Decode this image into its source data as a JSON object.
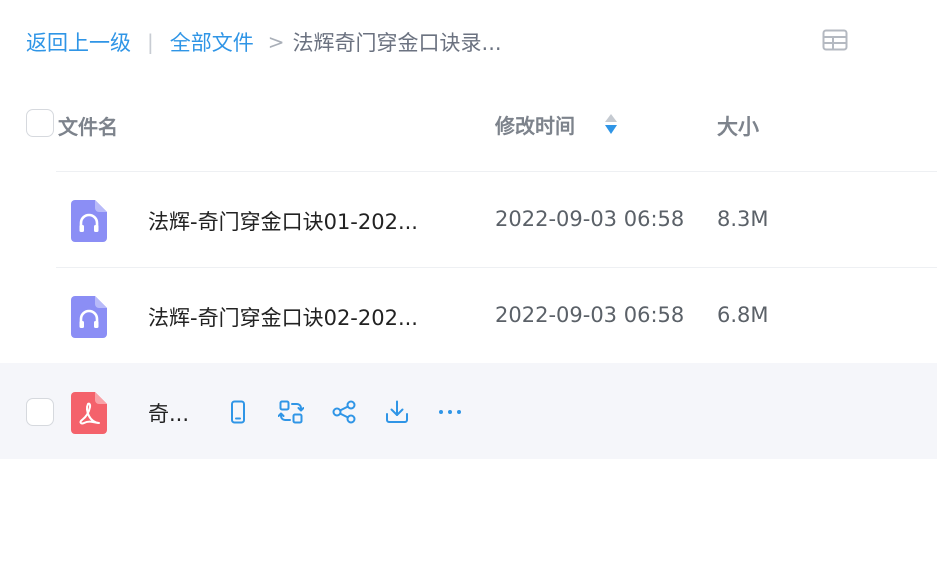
{
  "breadcrumb": {
    "back_label": "返回上一级",
    "separator": "|",
    "all_files_label": "全部文件",
    "arrow": ">",
    "current_folder": "法辉奇门穿金口诀录..."
  },
  "columns": {
    "name": "文件名",
    "modified": "修改时间",
    "size": "大小"
  },
  "files": [
    {
      "name": "法辉-奇门穿金口诀01-202...",
      "modified": "2022-09-03 06:58",
      "size": "8.3M",
      "icon": "audio-file-icon"
    },
    {
      "name": "法辉-奇门穿金口诀02-202...",
      "modified": "2022-09-03 06:58",
      "size": "6.8M",
      "icon": "audio-file-icon"
    },
    {
      "name": "奇...",
      "icon": "pdf-file-icon"
    }
  ],
  "row_actions": [
    "phone-icon",
    "convert-icon",
    "share-icon",
    "download-icon",
    "more-icon"
  ],
  "colors": {
    "accent": "#2f95e6",
    "audio_icon": "#8b8ef5",
    "pdf_icon": "#f4626b",
    "hover_row": "#f5f6fa"
  }
}
